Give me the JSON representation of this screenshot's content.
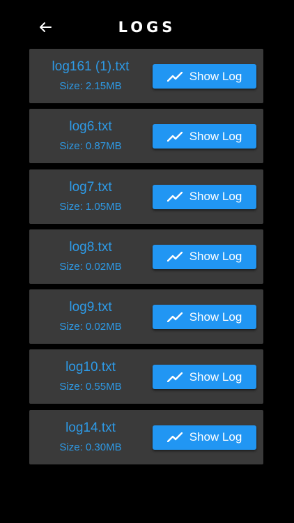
{
  "header": {
    "title": "LOGS",
    "back_icon": "arrow-left-icon"
  },
  "colors": {
    "background": "#000000",
    "card": "#3a3a3a",
    "accent_text": "#2e9ae6",
    "button": "#2196f3",
    "button_text": "#ffffff"
  },
  "logs": [
    {
      "name": "log161 (1).txt",
      "size": "Size: 2.15MB",
      "button_label": "Show Log",
      "button_icon": "trending-up-icon"
    },
    {
      "name": "log6.txt",
      "size": "Size: 0.87MB",
      "button_label": "Show Log",
      "button_icon": "trending-up-icon"
    },
    {
      "name": "log7.txt",
      "size": "Size: 1.05MB",
      "button_label": "Show Log",
      "button_icon": "trending-up-icon"
    },
    {
      "name": "log8.txt",
      "size": "Size: 0.02MB",
      "button_label": "Show Log",
      "button_icon": "trending-up-icon"
    },
    {
      "name": "log9.txt",
      "size": "Size: 0.02MB",
      "button_label": "Show Log",
      "button_icon": "trending-up-icon"
    },
    {
      "name": "log10.txt",
      "size": "Size: 0.55MB",
      "button_label": "Show Log",
      "button_icon": "trending-up-icon"
    },
    {
      "name": "log14.txt",
      "size": "Size: 0.30MB",
      "button_label": "Show Log",
      "button_icon": "trending-up-icon"
    }
  ]
}
